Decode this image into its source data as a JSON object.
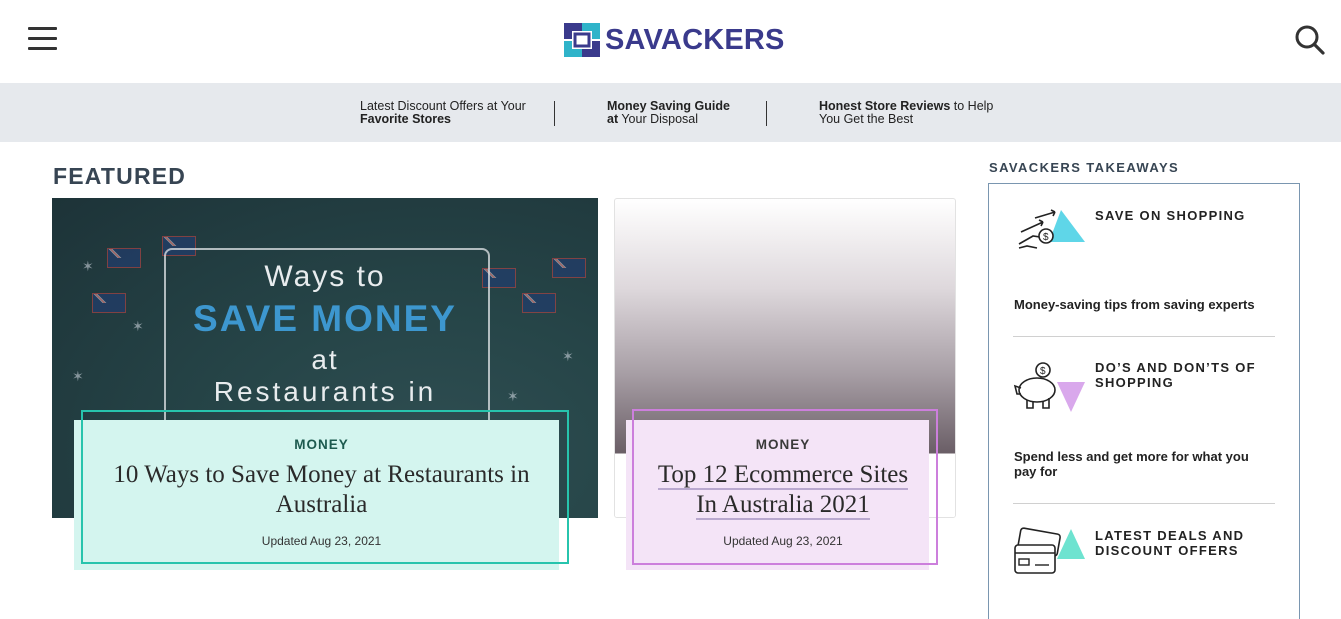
{
  "header": {
    "brand": "SAVACKERS",
    "menu_icon": "hamburger-menu-icon",
    "search_icon": "search-icon"
  },
  "strip": {
    "items": [
      {
        "normal_1": "Latest Discount Offers at Your",
        "bold_2": "Favorite Stores"
      },
      {
        "bold_1": "Money Saving Guide",
        "bold_2a": "at",
        "normal_2": " Your Disposal"
      },
      {
        "bold_1": "Honest Store Reviews",
        "normal_1": " to Help",
        "normal_2": "You Get the Best"
      }
    ]
  },
  "featured": {
    "heading": "FEATURED",
    "cards": [
      {
        "image_text": {
          "line1": "Ways to",
          "line2": "SAVE MONEY",
          "line3": "at",
          "line4": "Restaurants in"
        },
        "category": "MONEY",
        "title": "10 Ways to Save Money at Restaurants in Australia",
        "date": "Updated Aug 23, 2021",
        "accent": "#27c4ad"
      },
      {
        "category": "MONEY",
        "title_line1": "Top 12 Ecommerce Sites",
        "title_line2": "In Australia 2021",
        "date": "Updated Aug 23, 2021",
        "accent": "#cc7fdc"
      }
    ]
  },
  "sidebar": {
    "title": "SAVACKERS TAKEAWAYS",
    "items": [
      {
        "heading": "SAVE ON SHOPPING",
        "desc": "Money-saving tips from saving experts",
        "icon": "money-hand-icon",
        "accent": "#5fd6e8"
      },
      {
        "heading": "DO’S AND DON’TS OF SHOPPING",
        "desc": "Spend less and get more for what you pay for",
        "icon": "piggy-bank-icon",
        "accent": "#d9a8ec"
      },
      {
        "heading": "LATEST DEALS AND DISCOUNT OFFERS",
        "desc": "",
        "icon": "wallet-cards-icon",
        "accent": "#6ee3d0"
      }
    ]
  }
}
